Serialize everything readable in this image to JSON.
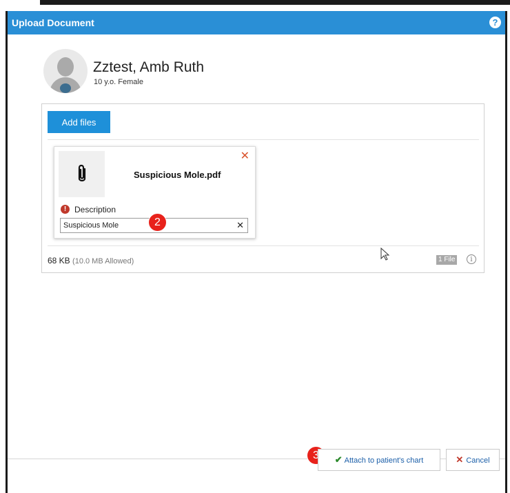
{
  "dialog": {
    "title": "Upload Document",
    "help_icon": "help-icon"
  },
  "patient": {
    "name": "Zztest, Amb Ruth",
    "info": "10 y.o. Female"
  },
  "upload": {
    "add_files_label": "Add files",
    "file": {
      "name": "Suspicious Mole.pdf",
      "thumbnail_icon": "paperclip-icon"
    },
    "description": {
      "label": "Description",
      "value": "Suspicious Mole"
    },
    "size": "68 KB",
    "allowed": "(10.0 MB Allowed)",
    "file_count": "1 File"
  },
  "callouts": {
    "step2": "2",
    "step3": "3"
  },
  "footer": {
    "attach_label": "Attach to patient's chart",
    "cancel_label": "Cancel"
  },
  "colors": {
    "titlebar": "#2a8fd6",
    "primary_button": "#1e90d9",
    "error": "#c0392b",
    "callout": "#e8221b",
    "remove": "#d9532c",
    "check": "#2d8a2d"
  }
}
